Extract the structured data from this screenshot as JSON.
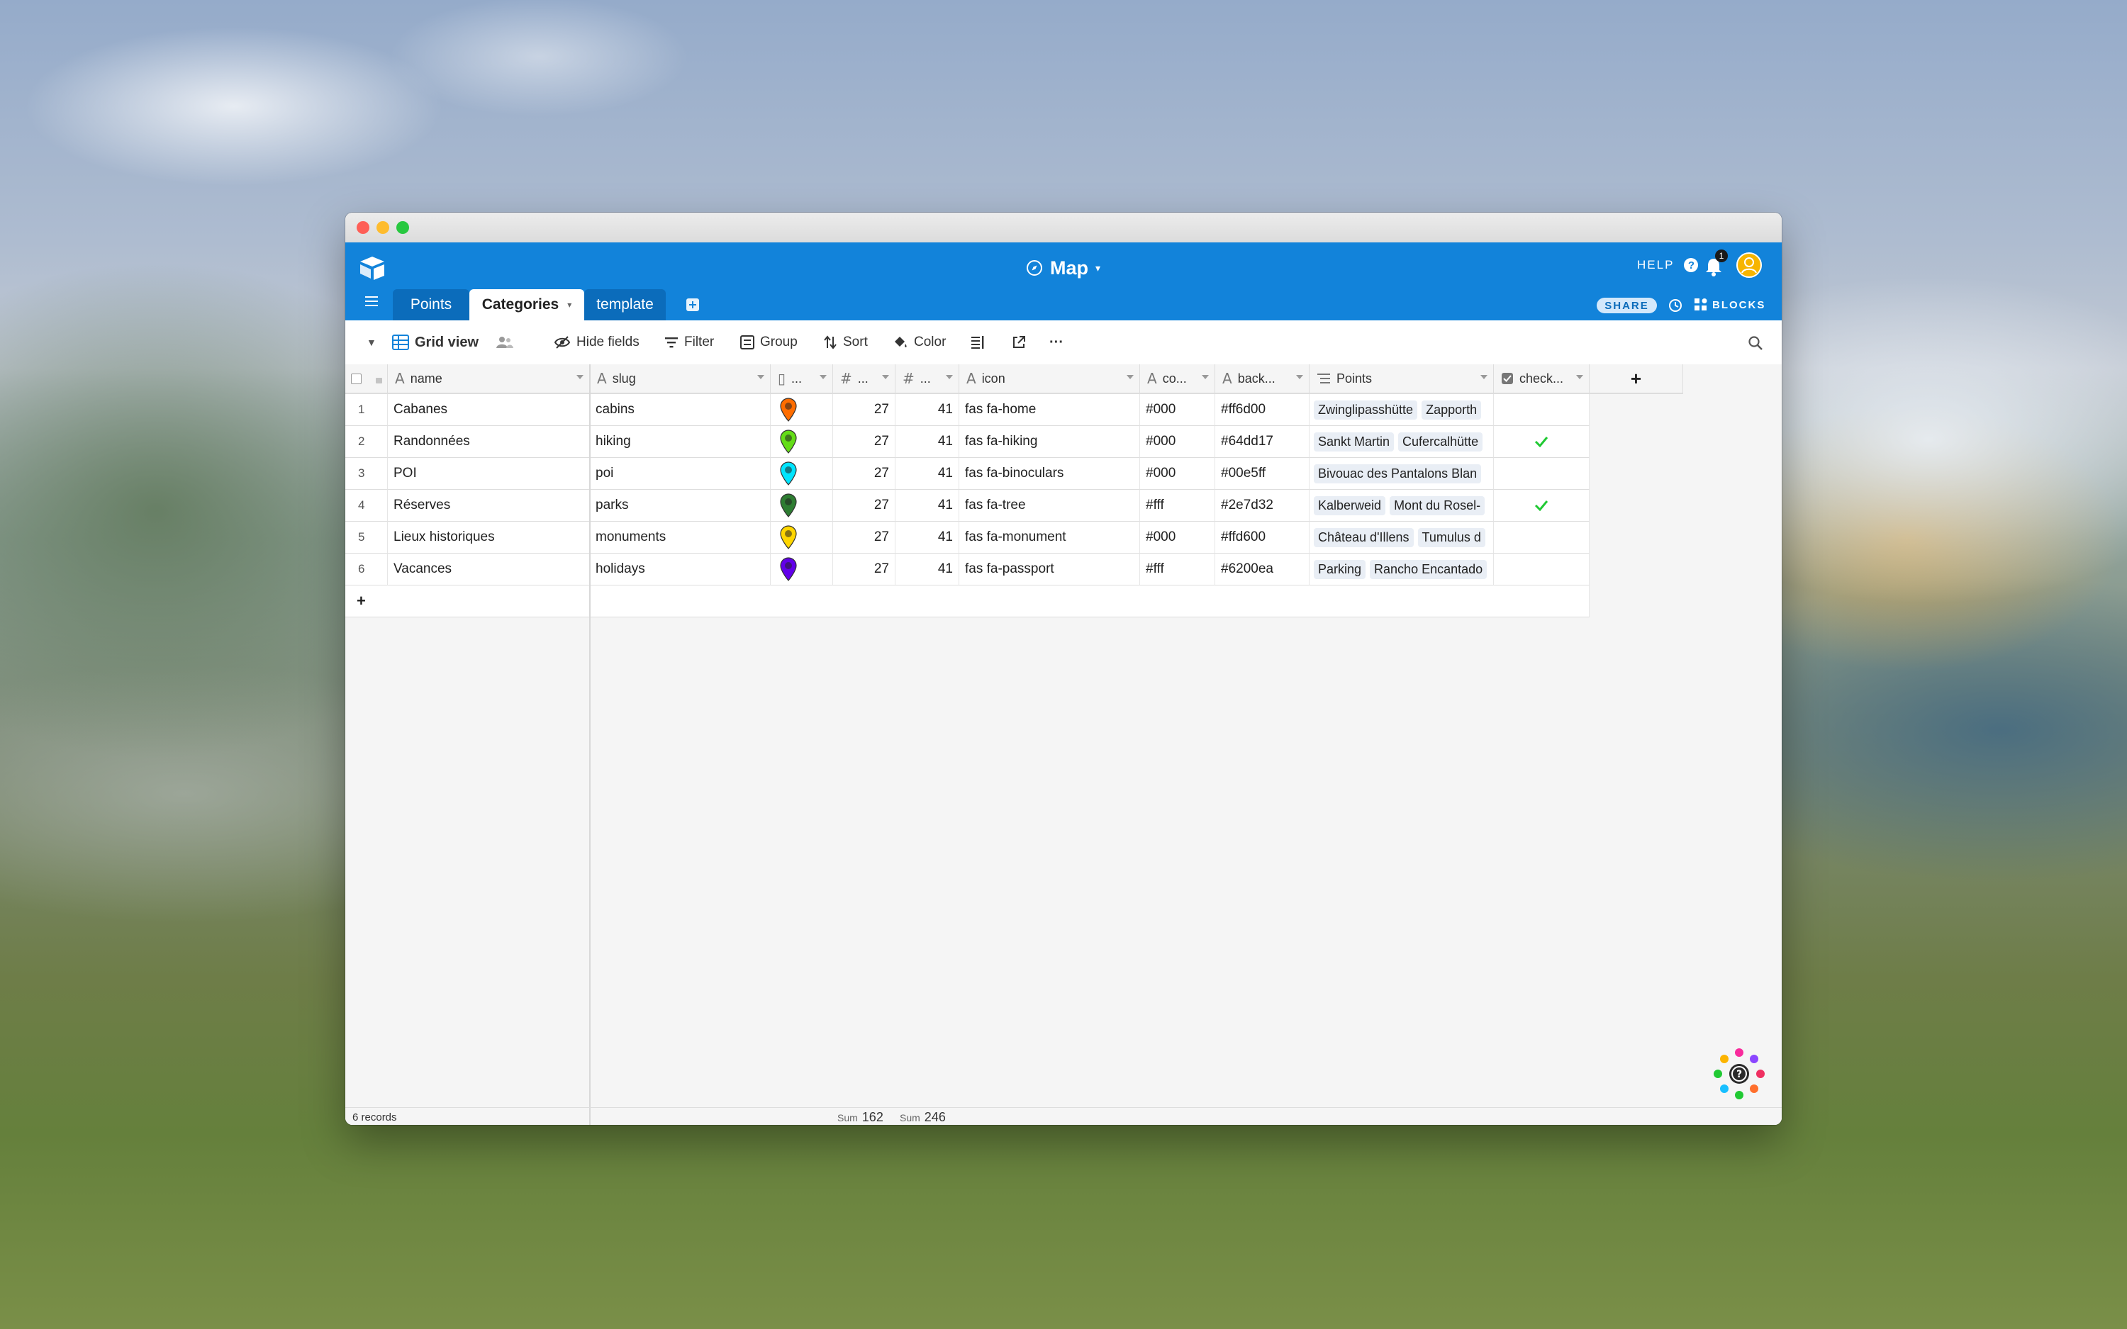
{
  "app": {
    "base_title": "Map",
    "help_label": "HELP",
    "notification_count": "1",
    "share_label": "SHARE",
    "blocks_label": "BLOCKS",
    "accent_color": "#1283da"
  },
  "tabs": [
    {
      "label": "Points",
      "active": false
    },
    {
      "label": "Categories",
      "active": true
    },
    {
      "label": "template",
      "active": false
    }
  ],
  "toolbar": {
    "view_name": "Grid view",
    "hide_fields": "Hide fields",
    "filter": "Filter",
    "group": "Group",
    "sort": "Sort",
    "color": "Color",
    "more": "···"
  },
  "columns": [
    "name",
    "slug",
    "...",
    "...",
    "...",
    "icon",
    "co...",
    "back...",
    "Points",
    "check..."
  ],
  "rows": [
    {
      "num": "1",
      "name": "Cabanes",
      "slug": "cabins",
      "marker_color": "#ff6d00",
      "n1": "27",
      "n2": "41",
      "icon": "fas fa-home",
      "color": "#000",
      "background": "#ff6d00",
      "points": [
        "Zwinglipasshütte",
        "Zapporth"
      ],
      "checked": false
    },
    {
      "num": "2",
      "name": "Randonnées",
      "slug": "hiking",
      "marker_color": "#64dd17",
      "n1": "27",
      "n2": "41",
      "icon": "fas fa-hiking",
      "color": "#000",
      "background": "#64dd17",
      "points": [
        "Sankt Martin",
        "Cufercalhütte"
      ],
      "checked": true
    },
    {
      "num": "3",
      "name": "POI",
      "slug": "poi",
      "marker_color": "#00e5ff",
      "n1": "27",
      "n2": "41",
      "icon": "fas fa-binoculars",
      "color": "#000",
      "background": "#00e5ff",
      "points": [
        "Bivouac des Pantalons Blan"
      ],
      "checked": false
    },
    {
      "num": "4",
      "name": "Réserves",
      "slug": "parks",
      "marker_color": "#2e7d32",
      "n1": "27",
      "n2": "41",
      "icon": "fas fa-tree",
      "color": "#fff",
      "background": "#2e7d32",
      "points": [
        "Kalberweid",
        "Mont du Rosel-"
      ],
      "checked": true
    },
    {
      "num": "5",
      "name": "Lieux historiques",
      "slug": "monuments",
      "marker_color": "#ffd600",
      "n1": "27",
      "n2": "41",
      "icon": "fas fa-monument",
      "color": "#000",
      "background": "#ffd600",
      "points": [
        "Château d'Illens",
        "Tumulus d"
      ],
      "checked": false
    },
    {
      "num": "6",
      "name": "Vacances",
      "slug": "holidays",
      "marker_color": "#6200ea",
      "n1": "27",
      "n2": "41",
      "icon": "fas fa-passport",
      "color": "#fff",
      "background": "#6200ea",
      "points": [
        "Parking",
        "Rancho Encantado"
      ],
      "checked": false
    }
  ],
  "footer": {
    "records": "6 records",
    "sum_label_1": "Sum",
    "sum_value_1": "162",
    "sum_label_2": "Sum",
    "sum_value_2": "246"
  },
  "add_row_symbol": "+",
  "add_field_symbol": "+"
}
